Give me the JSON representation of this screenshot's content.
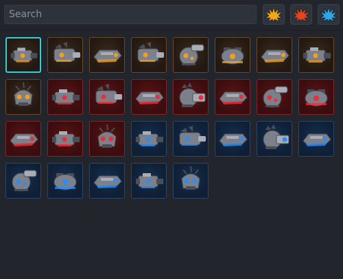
{
  "search": {
    "placeholder": "Search",
    "value": ""
  },
  "filters": [
    {
      "name": "filter-orange",
      "icon": "burst-icon",
      "color": "#f0a818"
    },
    {
      "name": "filter-red",
      "icon": "burst-icon",
      "color": "#e0481c"
    },
    {
      "name": "filter-blue",
      "icon": "burst-icon",
      "color": "#2aa8e8"
    }
  ],
  "items": [
    {
      "faction": "orange",
      "icon": "gun-turret-icon",
      "selected": true
    },
    {
      "faction": "orange",
      "icon": "spiked-cannon-icon"
    },
    {
      "faction": "orange",
      "icon": "hover-ship-icon"
    },
    {
      "faction": "orange",
      "icon": "spiked-cannon-icon"
    },
    {
      "faction": "orange",
      "icon": "mech-head-icon"
    },
    {
      "faction": "orange",
      "icon": "crab-mech-icon"
    },
    {
      "faction": "orange",
      "icon": "hover-ship-icon"
    },
    {
      "faction": "orange",
      "icon": "gun-turret-icon"
    },
    {
      "faction": "orange",
      "icon": "skull-drone-icon"
    },
    {
      "faction": "red",
      "icon": "gun-turret-icon"
    },
    {
      "faction": "red",
      "icon": "spiked-cannon-icon"
    },
    {
      "faction": "red",
      "icon": "hover-ship-icon"
    },
    {
      "faction": "red",
      "icon": "big-cannon-icon"
    },
    {
      "faction": "red",
      "icon": "hover-ship-icon"
    },
    {
      "faction": "red",
      "icon": "mech-head-icon"
    },
    {
      "faction": "red",
      "icon": "crab-mech-icon"
    },
    {
      "faction": "red",
      "icon": "hover-ship-icon"
    },
    {
      "faction": "red",
      "icon": "gun-turret-icon"
    },
    {
      "faction": "red",
      "icon": "skull-drone-icon"
    },
    {
      "faction": "blue",
      "icon": "gun-turret-icon"
    },
    {
      "faction": "blue",
      "icon": "spiked-cannon-icon"
    },
    {
      "faction": "blue",
      "icon": "hover-ship-icon"
    },
    {
      "faction": "blue",
      "icon": "big-cannon-icon"
    },
    {
      "faction": "blue",
      "icon": "hover-ship-icon"
    },
    {
      "faction": "blue",
      "icon": "mech-head-icon"
    },
    {
      "faction": "blue",
      "icon": "crab-mech-icon"
    },
    {
      "faction": "blue",
      "icon": "hover-ship-icon"
    },
    {
      "faction": "blue",
      "icon": "gun-turret-icon"
    },
    {
      "faction": "blue",
      "icon": "skull-drone-icon"
    }
  ],
  "faction_colors": {
    "orange": "#f0a020",
    "red": "#e8303a",
    "blue": "#2f8cf0"
  }
}
